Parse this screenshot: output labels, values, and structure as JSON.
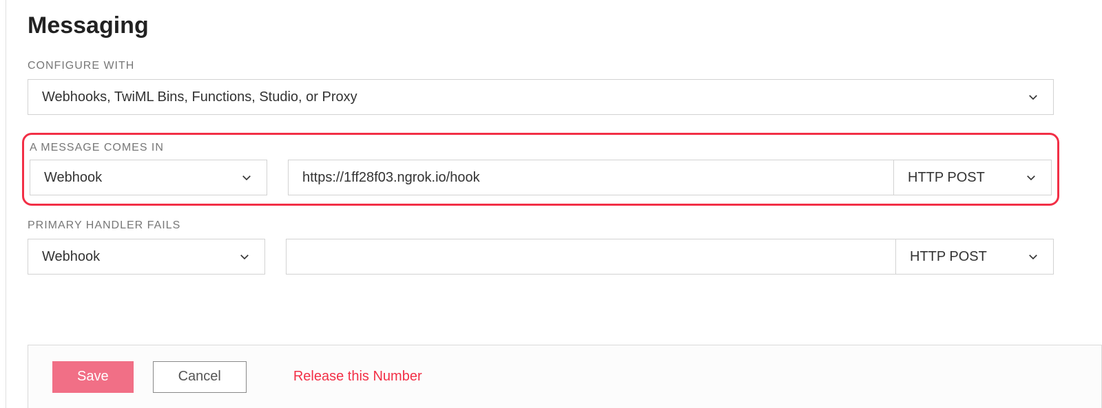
{
  "page": {
    "title": "Messaging"
  },
  "labels": {
    "configure_with": "CONFIGURE WITH",
    "message_comes_in": "A MESSAGE COMES IN",
    "primary_handler_fails": "PRIMARY HANDLER FAILS"
  },
  "configure_with": {
    "selected": "Webhooks, TwiML Bins, Functions, Studio, or Proxy"
  },
  "message_in": {
    "handler_type": "Webhook",
    "url": "https://1ff28f03.ngrok.io/hook",
    "method": "HTTP POST"
  },
  "primary_fail": {
    "handler_type": "Webhook",
    "url": "",
    "method": "HTTP POST"
  },
  "footer": {
    "save": "Save",
    "cancel": "Cancel",
    "release": "Release this Number"
  }
}
